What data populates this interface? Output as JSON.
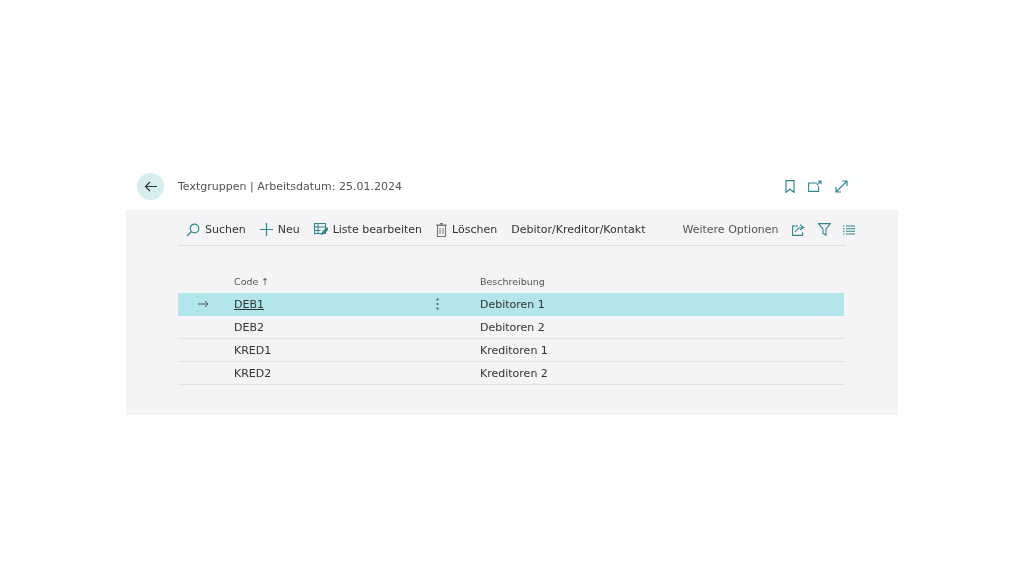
{
  "header": {
    "title": "Textgruppen | Arbeitsdatum: 25.01.2024"
  },
  "toolbar": {
    "actions": [
      {
        "label": "Suchen"
      },
      {
        "label": "Neu"
      },
      {
        "label": "Liste bearbeiten"
      },
      {
        "label": "Löschen"
      },
      {
        "label": "Debitor/Kreditor/Kontakt"
      }
    ],
    "more": "Weitere Optionen"
  },
  "table": {
    "columns": [
      {
        "label": "Code",
        "sort_mark": "↑"
      },
      {
        "label": "Beschreibung"
      }
    ],
    "rows": [
      {
        "code": "DEB1",
        "description": "Debitoren 1",
        "selected": true
      },
      {
        "code": "DEB2",
        "description": "Debitoren 2",
        "selected": false
      },
      {
        "code": "KRED1",
        "description": "Kreditoren 1",
        "selected": false
      },
      {
        "code": "KRED2",
        "description": "Kreditoren 2",
        "selected": false
      }
    ]
  }
}
